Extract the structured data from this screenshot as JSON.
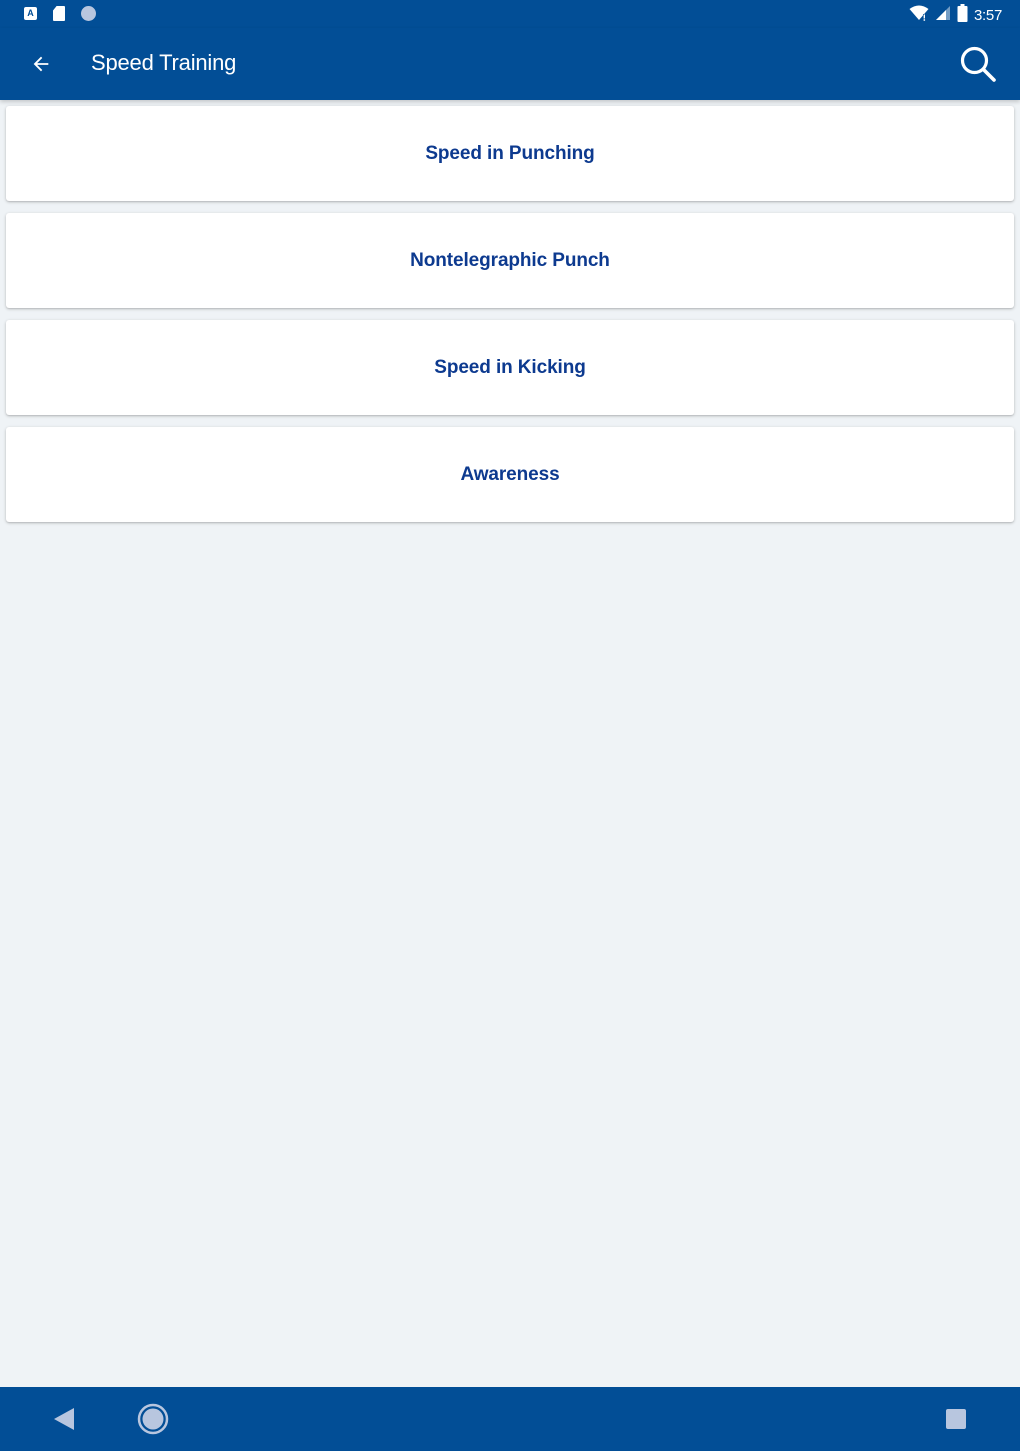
{
  "status_bar": {
    "time": "3:57",
    "left_icons": [
      "a-notification-icon",
      "sd-card-icon",
      "circle-notification-icon"
    ],
    "right_icons": [
      "wifi-icon",
      "signal-icon",
      "battery-icon"
    ],
    "a_glyph": "A"
  },
  "app_bar": {
    "title": "Speed Training",
    "back_icon": "arrow-back-icon",
    "search_icon": "search-icon"
  },
  "items": [
    {
      "label": "Speed in Punching"
    },
    {
      "label": "Nontelegraphic Punch"
    },
    {
      "label": "Speed in Kicking"
    },
    {
      "label": "Awareness"
    }
  ],
  "nav_bar": {
    "icons": [
      "nav-back-icon",
      "nav-home-icon",
      "nav-recents-icon"
    ]
  },
  "colors": {
    "primary": "#024e96",
    "background": "#eff3f6",
    "card": "#ffffff",
    "card_text": "#0d3a8f"
  }
}
